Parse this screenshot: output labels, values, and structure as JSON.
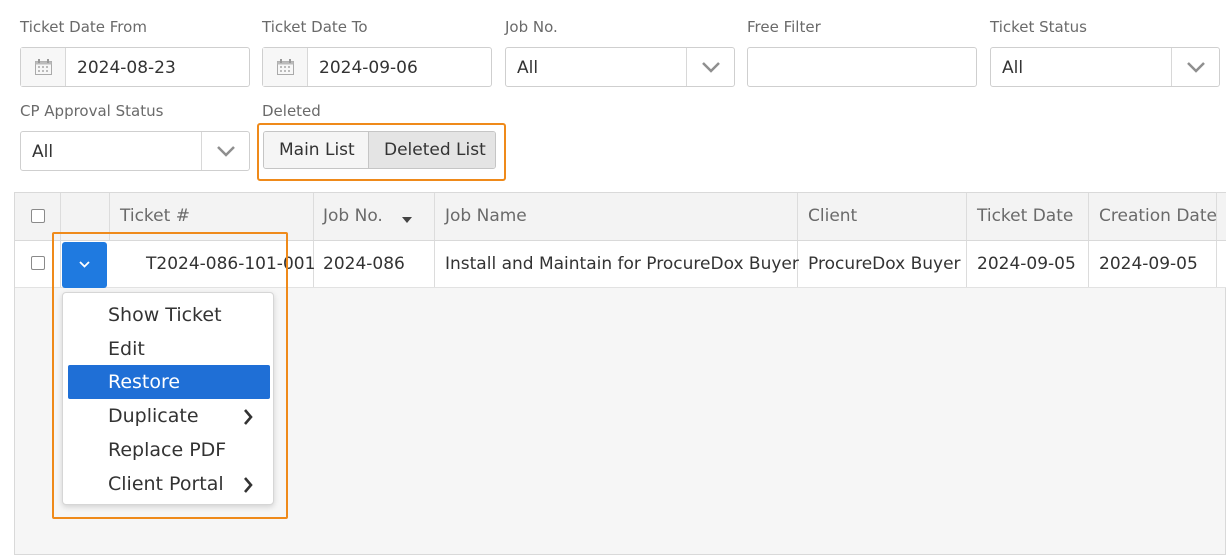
{
  "filters": {
    "ticket_date_from": {
      "label": "Ticket Date From",
      "value": "2024-08-23"
    },
    "ticket_date_to": {
      "label": "Ticket Date To",
      "value": "2024-09-06"
    },
    "job_no": {
      "label": "Job No.",
      "value": "All"
    },
    "free_filter": {
      "label": "Free Filter",
      "value": ""
    },
    "ticket_status": {
      "label": "Ticket Status",
      "value": "All"
    },
    "cp_approval_status": {
      "label": "CP Approval Status",
      "value": "All"
    },
    "deleted": {
      "label": "Deleted",
      "main_list": "Main List",
      "deleted_list": "Deleted List",
      "selected": "Deleted List"
    }
  },
  "table": {
    "headers": {
      "ticket": "Ticket #",
      "job_no": "Job No.",
      "job_name": "Job Name",
      "client": "Client",
      "ticket_date": "Ticket Date",
      "creation_date": "Creation Date"
    },
    "rows": [
      {
        "ticket": "T2024-086-101-001",
        "job_no": "2024-086",
        "job_name": "Install and Maintain for ProcureDox Buyer",
        "client": "ProcureDox Buyer",
        "ticket_date": "2024-09-05",
        "creation_date": "2024-09-05"
      }
    ]
  },
  "context_menu": {
    "items": [
      {
        "label": "Show Ticket"
      },
      {
        "label": "Edit"
      },
      {
        "label": "Restore",
        "active": true
      },
      {
        "label": "Duplicate",
        "submenu": true
      },
      {
        "label": "Replace PDF"
      },
      {
        "label": "Client Portal",
        "submenu": true
      }
    ]
  },
  "colors": {
    "accent": "#1f6fd6",
    "highlight": "#ef8a1a"
  }
}
